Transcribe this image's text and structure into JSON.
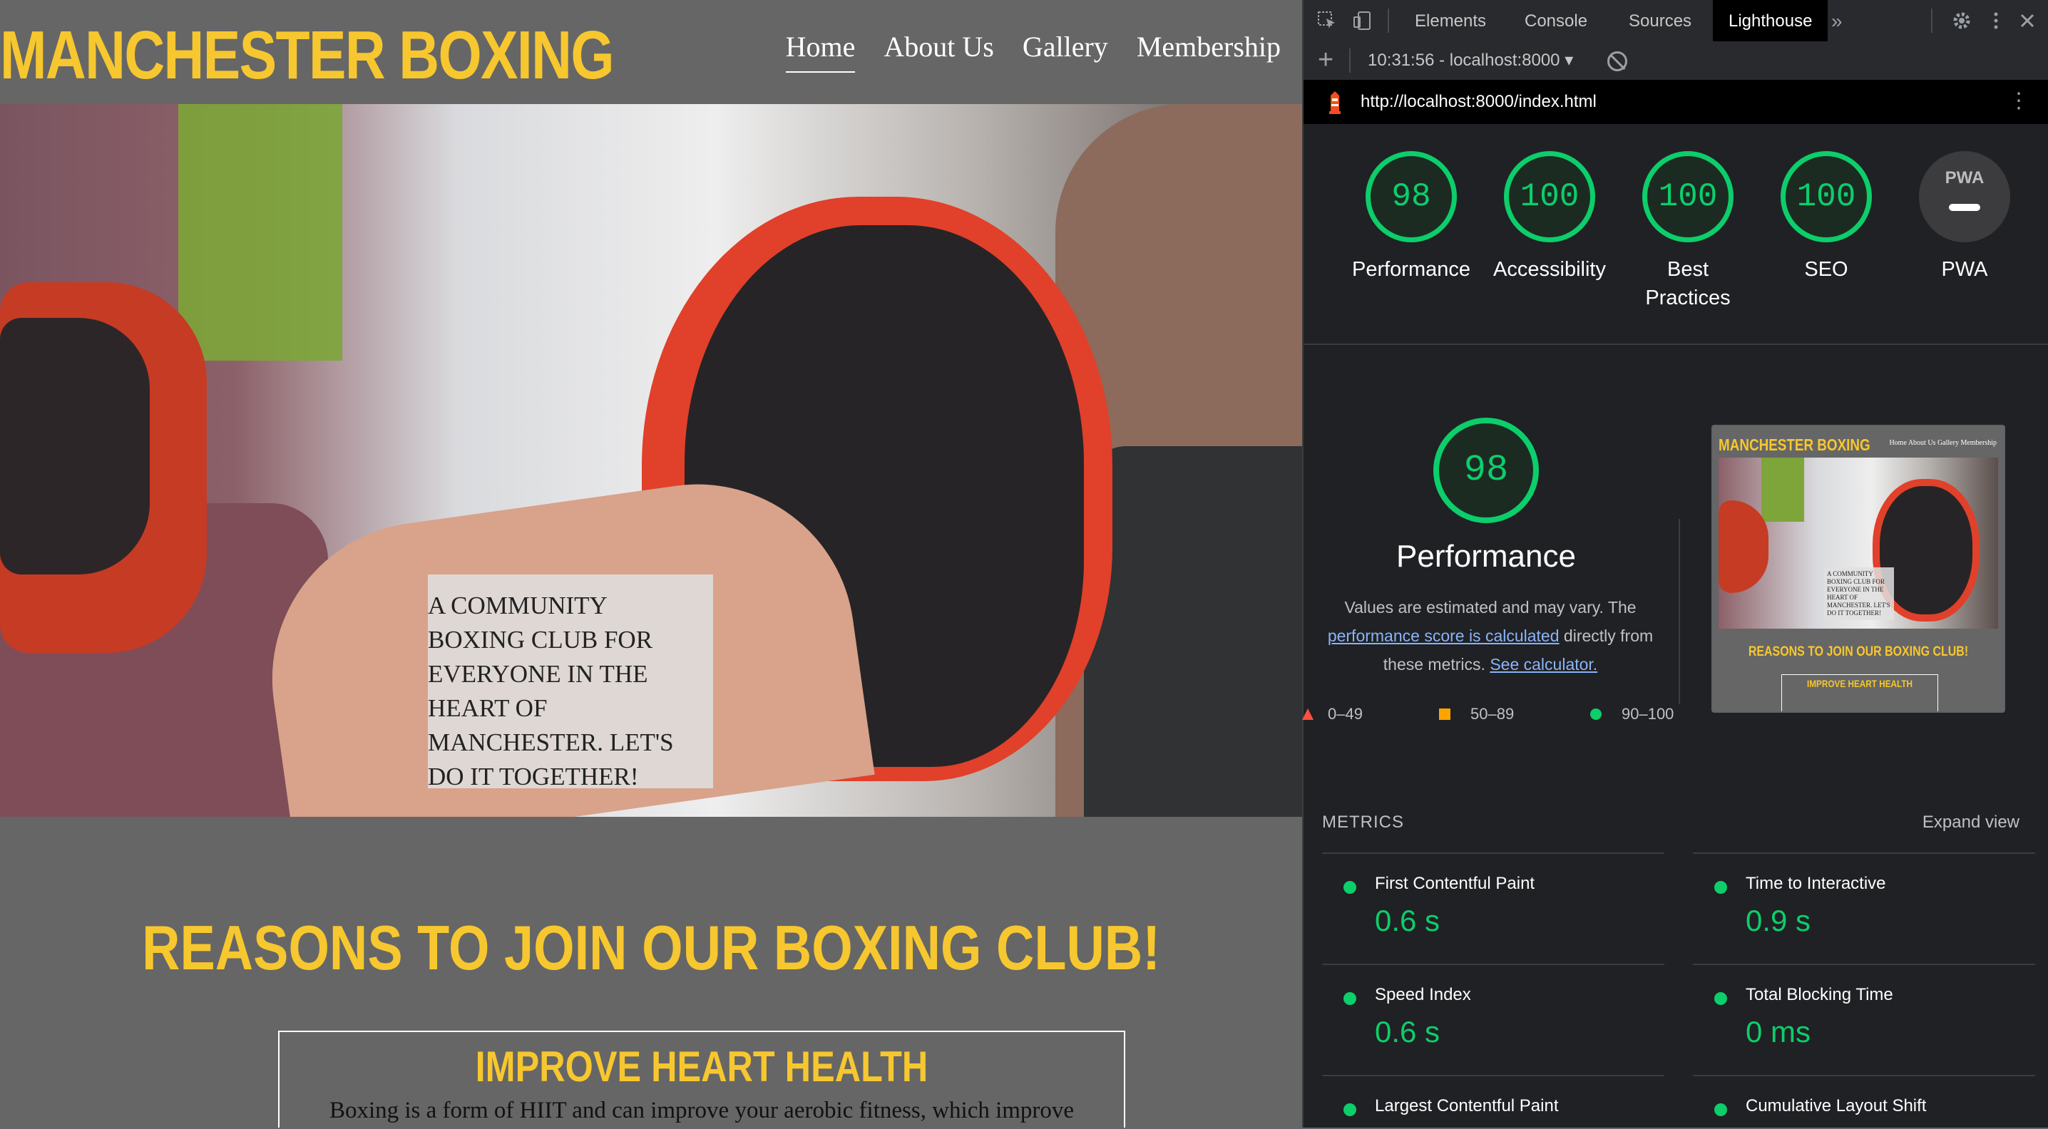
{
  "site": {
    "brand": "MANCHESTER BOXING",
    "nav": [
      "Home",
      "About Us",
      "Gallery",
      "Membership"
    ],
    "hero_caption": "A COMMUNITY BOXING CLUB FOR EVERYONE IN THE HEART OF MANCHESTER. LET'S DO IT TOGETHER!",
    "reasons_heading": "REASONS TO JOIN OUR BOXING CLUB!",
    "heart_title": "IMPROVE HEART HEALTH",
    "heart_text": "Boxing is a form of HIIT and can improve your aerobic fitness, which improve"
  },
  "devtools": {
    "tabs": [
      "Elements",
      "Console",
      "Sources",
      "Lighthouse"
    ],
    "active_tab": "Lighthouse",
    "more_tabs": "»",
    "report_select": "10:31:56 - localhost:8000 ▾",
    "url": "http://localhost:8000/index.html",
    "gauges": [
      {
        "score": "98",
        "label": "Performance"
      },
      {
        "score": "100",
        "label": "Accessibility"
      },
      {
        "score": "100",
        "label": "Best Practices"
      },
      {
        "score": "100",
        "label": "SEO"
      },
      {
        "score": "",
        "label": "PWA"
      }
    ],
    "pwa_badge": "PWA",
    "performance": {
      "score": "98",
      "title": "Performance",
      "desc_1": "Values are estimated and may vary. The",
      "link_1": "performance score is calculated",
      "desc_2": "directly from these metrics.",
      "link_2": "See calculator."
    },
    "legend": [
      "0–49",
      "50–89",
      "90–100"
    ],
    "metrics_label": "METRICS",
    "expand_view": "Expand view",
    "metrics": [
      {
        "name": "First Contentful Paint",
        "value": "0.6 s"
      },
      {
        "name": "Time to Interactive",
        "value": "0.9 s"
      },
      {
        "name": "Speed Index",
        "value": "0.6 s"
      },
      {
        "name": "Total Blocking Time",
        "value": "0 ms"
      },
      {
        "name": "Largest Contentful Paint",
        "value": ""
      },
      {
        "name": "Cumulative Layout Shift",
        "value": ""
      }
    ],
    "thumb": {
      "brand": "MANCHESTER BOXING",
      "nav": "Home   About Us   Gallery   Membership",
      "caption": "A COMMUNITY BOXING CLUB FOR EVERYONE IN THE HEART OF MANCHESTER. LET'S DO IT TOGETHER!",
      "reasons": "REASONS TO JOIN OUR BOXING CLUB!",
      "heart": "IMPROVE HEART HEALTH"
    },
    "colors": {
      "pass": "#0cce6b",
      "average": "#ffa400",
      "fail": "#ff4e42",
      "brand": "#f7c72f"
    }
  }
}
